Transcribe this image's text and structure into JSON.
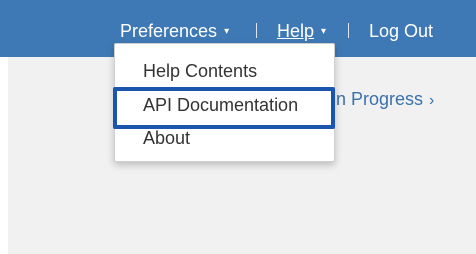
{
  "nav": {
    "preferences_label": "Preferences",
    "help_label": "Help",
    "logout_label": "Log Out",
    "separator": "|",
    "caret_glyph": "▾"
  },
  "background": {
    "partial_link_text": "s in Progress",
    "chevron_glyph": "›"
  },
  "help_menu": {
    "items": [
      {
        "label": "Help Contents"
      },
      {
        "label": "API Documentation",
        "highlighted": true
      },
      {
        "label": "About"
      }
    ]
  },
  "colors": {
    "topbar": "#3f79b5",
    "highlight_border": "#1a56b0",
    "link": "#3a71ad",
    "content_bg": "#f1f1f1"
  },
  "icons": {
    "dropdown_caret": "chevron-down-icon",
    "link_chevron": "chevron-right-icon"
  }
}
